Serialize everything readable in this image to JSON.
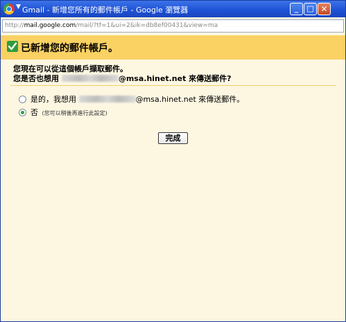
{
  "window": {
    "title": "Gmail - 新增您所有的郵件帳戶 - Google 瀏覽器",
    "controls": {
      "minimize": "_",
      "maximize": "□",
      "close": "✕"
    }
  },
  "address_bar": {
    "scheme": "http://",
    "host": "mail.google.com",
    "path": "/mail/?tf=1&ui=2&ik=db8ef00431&view=ma"
  },
  "header": {
    "title": "已新增您的郵件帳戶。"
  },
  "intro": {
    "line1": "您現在可以從這個帳戶擷取郵件。",
    "line2_prefix": "您是否也想用",
    "line2_domain": "@msa.hinet.net",
    "line2_suffix": " 來傳送郵件?"
  },
  "options": [
    {
      "label_prefix": "是的，我想用",
      "domain": "@msa.hinet.net",
      "label_suffix": " 來傳送郵件。",
      "checked": false
    },
    {
      "label": "否",
      "note": "(您可以稍後再進行此設定)",
      "checked": true
    }
  ],
  "done_button": {
    "label": "完成"
  },
  "colors": {
    "accent": "#fad163",
    "background": "#fdf7e2",
    "titlebar": "#2a5fdc",
    "check": "#2e9d3a"
  },
  "icons": [
    "chrome-app-icon",
    "checkmark-icon",
    "radio-icon"
  ]
}
